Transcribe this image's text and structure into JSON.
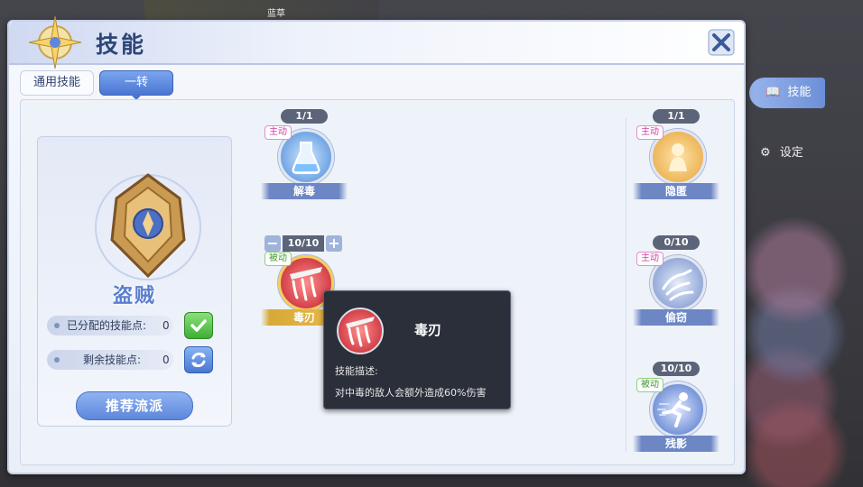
{
  "topbar": {
    "status_text": "蓝草"
  },
  "window": {
    "title": "技能"
  },
  "tabs": [
    {
      "label": "通用技能"
    },
    {
      "label": "一转"
    }
  ],
  "class_card": {
    "class_name": "盗贼",
    "allocated_label": "已分配的技能点:",
    "allocated_value": "0",
    "remaining_label": "剩余技能点:",
    "remaining_value": "0",
    "recommend_label": "推荐流派"
  },
  "skills": [
    {
      "name": "解毒",
      "count": "1/1",
      "type": "主动"
    },
    {
      "name": "毒刃",
      "count": "10/10",
      "type": "被动"
    },
    {
      "name": "隐匿",
      "count": "1/1",
      "type": "主动"
    },
    {
      "name": "偷窃",
      "count": "0/10",
      "type": "主动"
    },
    {
      "name": "残影",
      "count": "10/10",
      "type": "被动"
    }
  ],
  "tooltip": {
    "title": "毒刃",
    "label": "技能描述:",
    "description": "对中毒的敌人会额外造成60%伤害"
  },
  "side_menu": {
    "skill_label": "技能",
    "setting_label": "设定"
  },
  "colors": {
    "accent_blue": "#5e87dc",
    "gold": "#e6b94e",
    "active_tag": "#d03fa3",
    "passive_tag": "#3e9a2f"
  }
}
